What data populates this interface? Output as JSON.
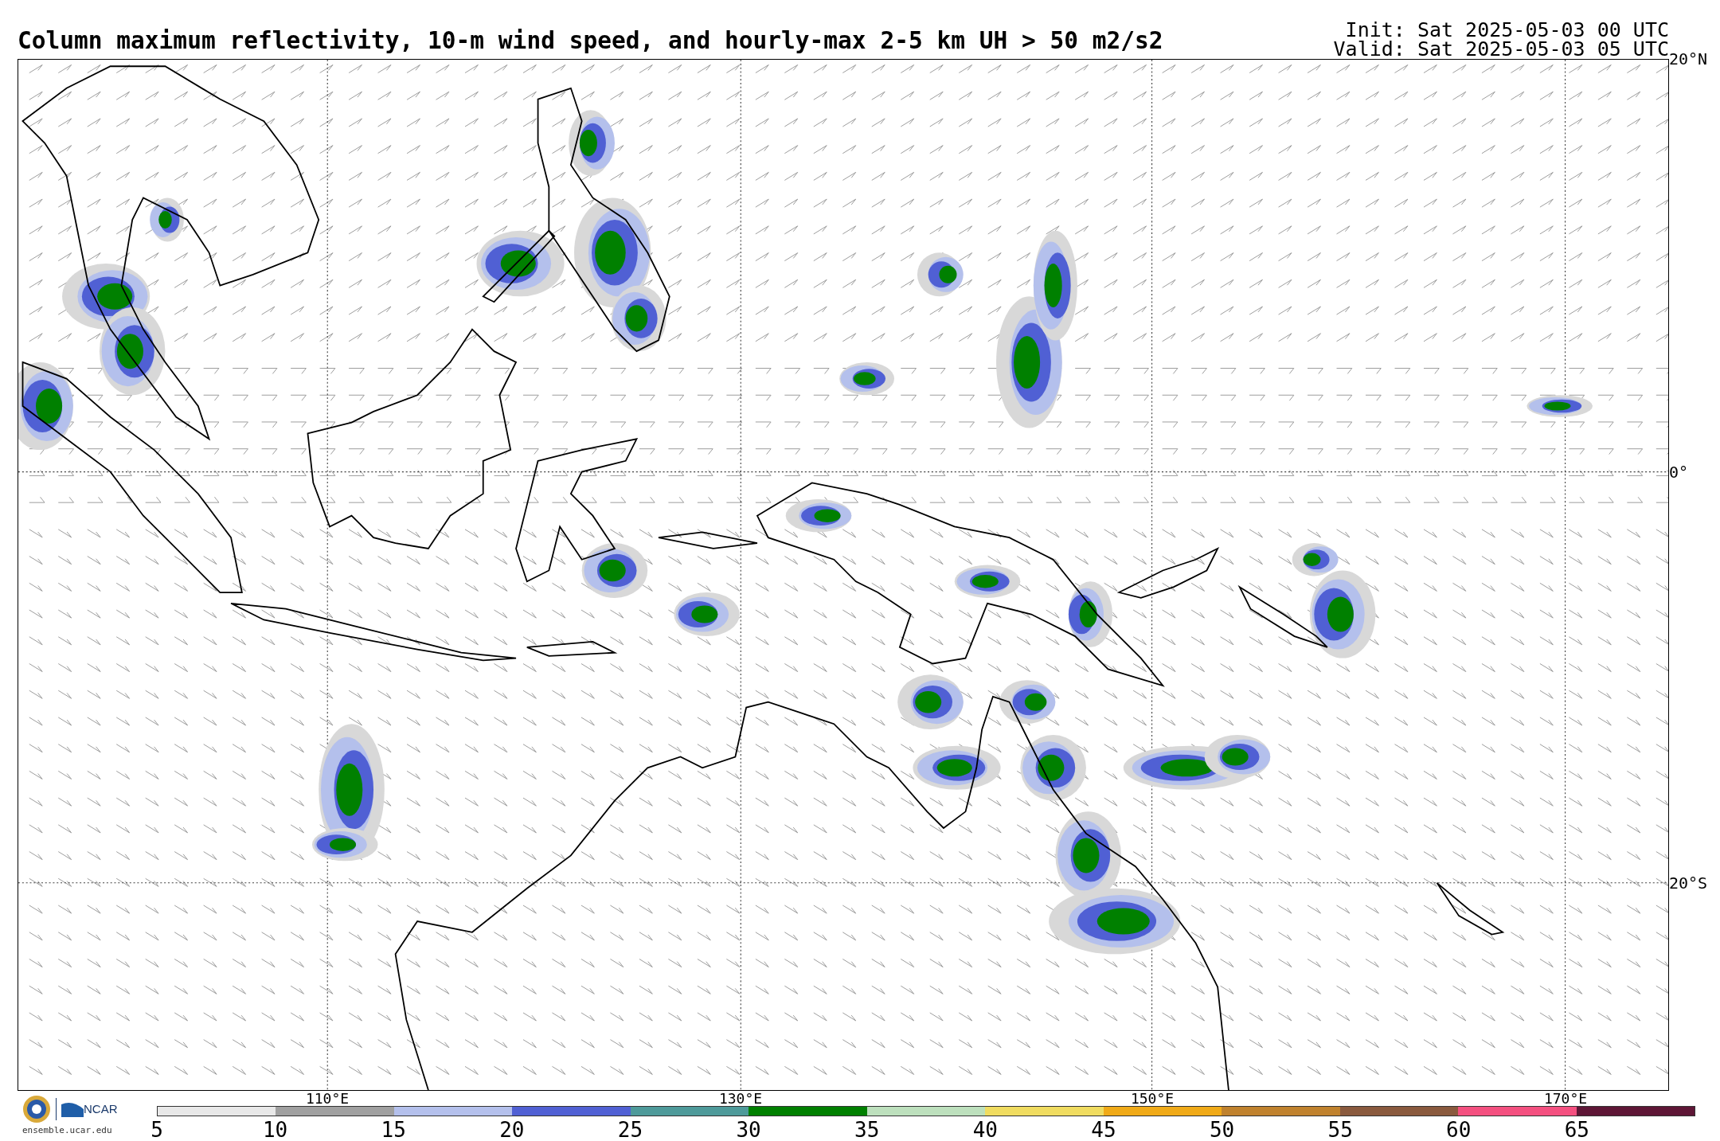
{
  "title": "Column maximum reflectivity, 10-m wind speed, and hourly-max 2-5 km UH > 50 m2/s2",
  "init": "Init: Sat 2025-05-03 00 UTC",
  "valid": "Valid: Sat 2025-05-03 05 UTC",
  "latitude_labels": [
    "20°N",
    "0°",
    "20°S"
  ],
  "longitude_labels": [
    "110°E",
    "130°E",
    "150°E",
    "170°E"
  ],
  "colorbar": {
    "bins": [
      {
        "color": "#e8e8e8"
      },
      {
        "color": "#a0a0a0"
      },
      {
        "color": "#b4c0ec"
      },
      {
        "color": "#5060d4"
      },
      {
        "color": "#4e9a9a"
      },
      {
        "color": "#008000"
      },
      {
        "color": "#bde0bd"
      },
      {
        "color": "#f0dc60"
      },
      {
        "color": "#f0aa18"
      },
      {
        "color": "#c0822e"
      },
      {
        "color": "#8a5a3e"
      },
      {
        "color": "#f45080"
      },
      {
        "color": "#5e1636"
      }
    ],
    "tick_labels": [
      "5",
      "10",
      "15",
      "20",
      "25",
      "30",
      "35",
      "40",
      "45",
      "50",
      "55",
      "60",
      "65"
    ]
  },
  "footer": {
    "logo": "NCAR",
    "url": "ensemble.ucar.edu"
  }
}
